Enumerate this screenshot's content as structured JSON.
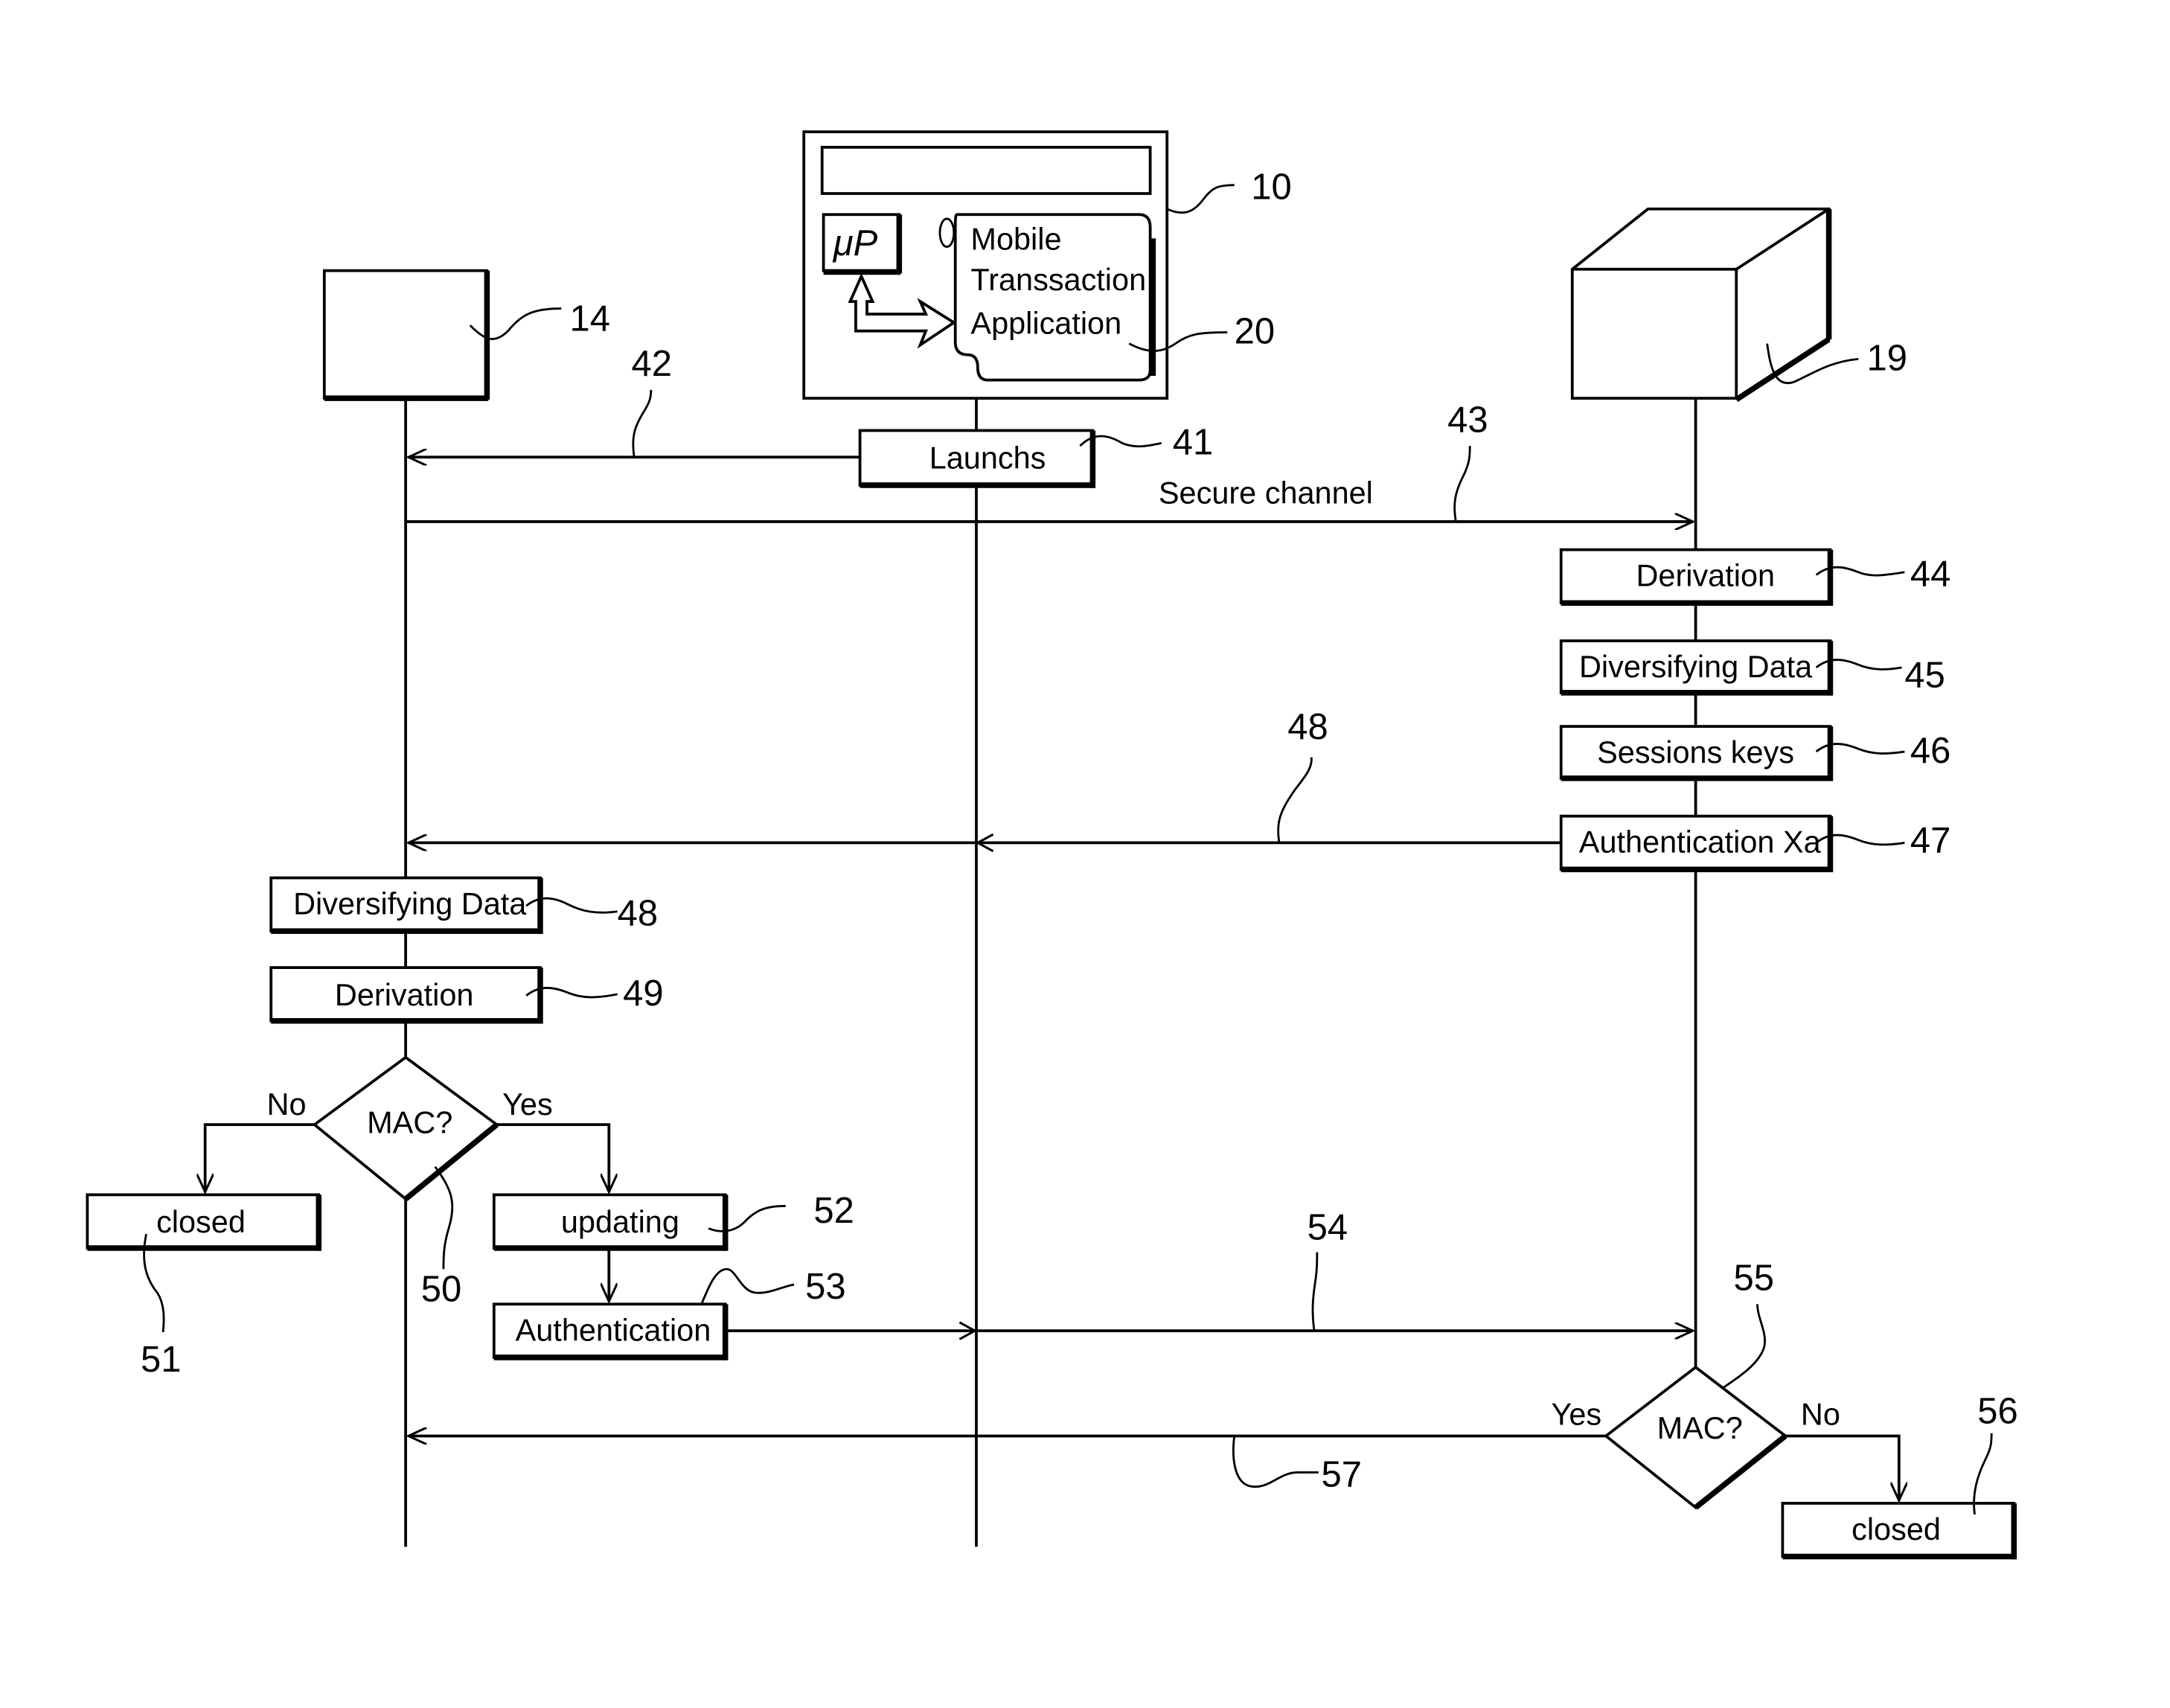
{
  "entities": {
    "terminal": {
      "ref": "14"
    },
    "mobile_device": {
      "ref": "10",
      "processor_label": "μP",
      "app_ref": "20",
      "app_lines": [
        "Mobile",
        "Transsaction",
        "Application"
      ]
    },
    "server": {
      "ref": "19"
    }
  },
  "steps": {
    "launchs": {
      "label": "Launchs",
      "ref": "41"
    },
    "arrow_42": {
      "ref": "42"
    },
    "secure_channel": {
      "label": "Secure channel",
      "ref": "43"
    },
    "server_derivation": {
      "label": "Derivation",
      "ref": "44"
    },
    "server_diversifying": {
      "label": "Diversifying Data",
      "ref": "45"
    },
    "sessions_keys": {
      "label": "Sessions keys",
      "ref": "46"
    },
    "auth_xa": {
      "label": "Authentication Xa",
      "ref": "47"
    },
    "arrow_48": {
      "ref": "48"
    },
    "term_diversifying": {
      "label": "Diversifying Data",
      "ref": "48"
    },
    "term_derivation": {
      "label": "Derivation",
      "ref": "49"
    },
    "mac_check_1": {
      "label": "MAC?",
      "ref": "50",
      "no": "No",
      "yes": "Yes"
    },
    "closed_1": {
      "label": "closed",
      "ref": "51"
    },
    "updating": {
      "label": "updating",
      "ref": "52"
    },
    "authentication": {
      "label": "Authentication",
      "ref": "53"
    },
    "arrow_54": {
      "ref": "54"
    },
    "mac_check_2": {
      "label": "MAC?",
      "ref": "55",
      "yes": "Yes",
      "no": "No"
    },
    "closed_2": {
      "label": "closed",
      "ref": "56"
    },
    "arrow_57": {
      "ref": "57"
    }
  }
}
